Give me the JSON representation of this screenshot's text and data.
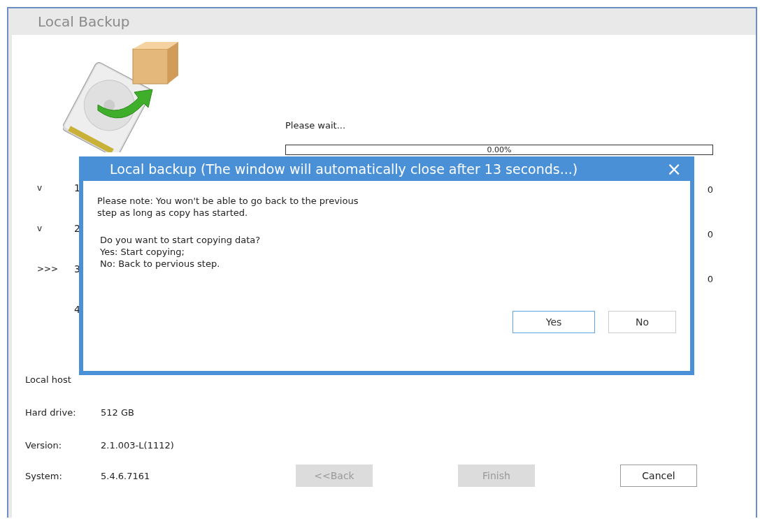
{
  "window": {
    "title": "Local Backup"
  },
  "steps": [
    {
      "marker": "v",
      "number": "1"
    },
    {
      "marker": "v",
      "number": "2"
    },
    {
      "marker": ">>>",
      "number": "3"
    },
    {
      "number": "4"
    }
  ],
  "progress": {
    "label": "Please wait...",
    "reading": "0.00%",
    "level": 0
  },
  "counters": [
    "0",
    "0",
    "0"
  ],
  "local_host": {
    "heading": "Local host",
    "fields": [
      {
        "label": "Hard drive:",
        "value": "512 GB"
      },
      {
        "label": "Version:",
        "value": "2.1.003-L(1112)"
      },
      {
        "label": "System:",
        "value": "5.4.6.7161"
      }
    ]
  },
  "buttons": [
    {
      "label": "<<Back",
      "disabled": true
    },
    {
      "label": "Finish",
      "disabled": true
    },
    {
      "label": "Cancel",
      "disabled": false
    }
  ],
  "dialog": {
    "title": "Local backup (The window will automatically close after 13 seconds...)",
    "close": "×",
    "message": [
      "Please note: You won't be able to go back to the previous",
      "step as long as copy has started."
    ],
    "details": [
      "Do you want to start copying data?",
      "Yes: Start copying;",
      "No: Back to pervious step."
    ],
    "buttons": [
      {
        "label": "Yes",
        "focused": true
      },
      {
        "label": "No",
        "focused": false
      }
    ]
  }
}
